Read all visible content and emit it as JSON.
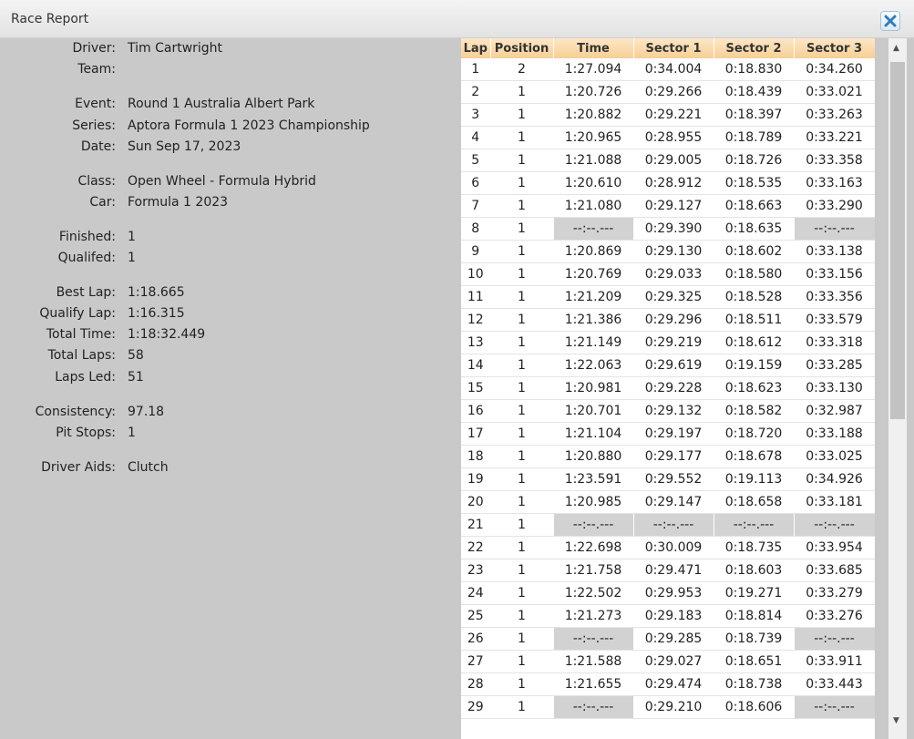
{
  "window": {
    "title": "Race Report"
  },
  "info": [
    {
      "label": "Driver:",
      "value": "Tim Cartwright"
    },
    {
      "label": "Team:",
      "value": ""
    },
    {
      "label": "Event:",
      "value": "Round 1 Australia Albert Park"
    },
    {
      "label": "Series:",
      "value": "Aptora Formula 1 2023 Championship"
    },
    {
      "label": "Date:",
      "value": "Sun Sep 17, 2023"
    },
    {
      "label": "Class:",
      "value": "Open Wheel - Formula Hybrid"
    },
    {
      "label": "Car:",
      "value": "Formula 1 2023"
    },
    {
      "label": "Finished:",
      "value": "1"
    },
    {
      "label": "Qualifed:",
      "value": "1"
    },
    {
      "label": "Best Lap:",
      "value": "1:18.665"
    },
    {
      "label": "Qualify Lap:",
      "value": "1:16.315"
    },
    {
      "label": "Total Time:",
      "value": "1:18:32.449"
    },
    {
      "label": "Total Laps:",
      "value": "58"
    },
    {
      "label": "Laps Led:",
      "value": "51"
    },
    {
      "label": "Consistency:",
      "value": "97.18"
    },
    {
      "label": "Pit Stops:",
      "value": "1"
    },
    {
      "label": "Driver Aids:",
      "value": "Clutch"
    }
  ],
  "laps": {
    "columns": [
      "Lap",
      "Position",
      "Time",
      "Sector 1",
      "Sector 2",
      "Sector 3"
    ],
    "rows": [
      [
        "1",
        "2",
        "1:27.094",
        "0:34.004",
        "0:18.830",
        "0:34.260"
      ],
      [
        "2",
        "1",
        "1:20.726",
        "0:29.266",
        "0:18.439",
        "0:33.021"
      ],
      [
        "3",
        "1",
        "1:20.882",
        "0:29.221",
        "0:18.397",
        "0:33.263"
      ],
      [
        "4",
        "1",
        "1:20.965",
        "0:28.955",
        "0:18.789",
        "0:33.221"
      ],
      [
        "5",
        "1",
        "1:21.088",
        "0:29.005",
        "0:18.726",
        "0:33.358"
      ],
      [
        "6",
        "1",
        "1:20.610",
        "0:28.912",
        "0:18.535",
        "0:33.163"
      ],
      [
        "7",
        "1",
        "1:21.080",
        "0:29.127",
        "0:18.663",
        "0:33.290"
      ],
      [
        "8",
        "1",
        "--:--.---",
        "0:29.390",
        "0:18.635",
        "--:--.---"
      ],
      [
        "9",
        "1",
        "1:20.869",
        "0:29.130",
        "0:18.602",
        "0:33.138"
      ],
      [
        "10",
        "1",
        "1:20.769",
        "0:29.033",
        "0:18.580",
        "0:33.156"
      ],
      [
        "11",
        "1",
        "1:21.209",
        "0:29.325",
        "0:18.528",
        "0:33.356"
      ],
      [
        "12",
        "1",
        "1:21.386",
        "0:29.296",
        "0:18.511",
        "0:33.579"
      ],
      [
        "13",
        "1",
        "1:21.149",
        "0:29.219",
        "0:18.612",
        "0:33.318"
      ],
      [
        "14",
        "1",
        "1:22.063",
        "0:29.619",
        "0:19.159",
        "0:33.285"
      ],
      [
        "15",
        "1",
        "1:20.981",
        "0:29.228",
        "0:18.623",
        "0:33.130"
      ],
      [
        "16",
        "1",
        "1:20.701",
        "0:29.132",
        "0:18.582",
        "0:32.987"
      ],
      [
        "17",
        "1",
        "1:21.104",
        "0:29.197",
        "0:18.720",
        "0:33.188"
      ],
      [
        "18",
        "1",
        "1:20.880",
        "0:29.177",
        "0:18.678",
        "0:33.025"
      ],
      [
        "19",
        "1",
        "1:23.591",
        "0:29.552",
        "0:19.113",
        "0:34.926"
      ],
      [
        "20",
        "1",
        "1:20.985",
        "0:29.147",
        "0:18.658",
        "0:33.181"
      ],
      [
        "21",
        "1",
        "--:--.---",
        "--:--.---",
        "--:--.---",
        "--:--.---"
      ],
      [
        "22",
        "1",
        "1:22.698",
        "0:30.009",
        "0:18.735",
        "0:33.954"
      ],
      [
        "23",
        "1",
        "1:21.758",
        "0:29.471",
        "0:18.603",
        "0:33.685"
      ],
      [
        "24",
        "1",
        "1:22.502",
        "0:29.953",
        "0:19.271",
        "0:33.279"
      ],
      [
        "25",
        "1",
        "1:21.273",
        "0:29.183",
        "0:18.814",
        "0:33.276"
      ],
      [
        "26",
        "1",
        "--:--.---",
        "0:29.285",
        "0:18.739",
        "--:--.---"
      ],
      [
        "27",
        "1",
        "1:21.588",
        "0:29.027",
        "0:18.651",
        "0:33.911"
      ],
      [
        "28",
        "1",
        "1:21.655",
        "0:29.474",
        "0:18.738",
        "0:33.443"
      ],
      [
        "29",
        "1",
        "--:--.---",
        "0:29.210",
        "0:18.606",
        "--:--.---"
      ]
    ],
    "blank_value": "--:--.---"
  },
  "colors": {
    "header_bg": "#f9d9a8",
    "blank_cell": "#d2d2d2",
    "panel_bg": "#c9c9c9",
    "close_icon": "#2e7dbf"
  },
  "icons": {
    "close": "close-icon",
    "scroll_up": "scroll-up-arrow-icon",
    "scroll_down": "scroll-down-arrow-icon"
  }
}
